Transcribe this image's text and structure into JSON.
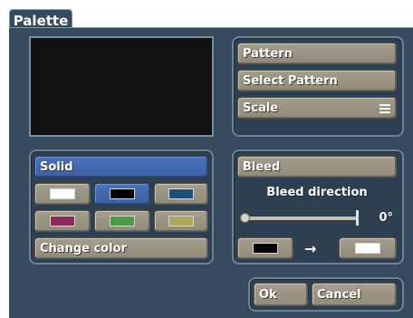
{
  "window": {
    "title": "Palette"
  },
  "pattern_panel": {
    "pattern_label": "Pattern",
    "select_pattern_label": "Select Pattern",
    "scale_label": "Scale"
  },
  "color_panel": {
    "mode_label": "Solid",
    "change_color_label": "Change color",
    "swatches": [
      {
        "color": "#ffffff",
        "selected": false
      },
      {
        "color": "#000000",
        "selected": true
      },
      {
        "color": "#1f4f78",
        "selected": false
      },
      {
        "color": "#8a2d5b",
        "selected": false
      },
      {
        "color": "#4f9a4a",
        "selected": false
      },
      {
        "color": "#aca55e",
        "selected": false
      }
    ]
  },
  "bleed_panel": {
    "bleed_label": "Bleed",
    "direction_label": "Bleed direction",
    "direction_value": "0°",
    "from_color": "#000000",
    "to_color": "#ffffff"
  },
  "actions": {
    "ok_label": "Ok",
    "cancel_label": "Cancel"
  }
}
